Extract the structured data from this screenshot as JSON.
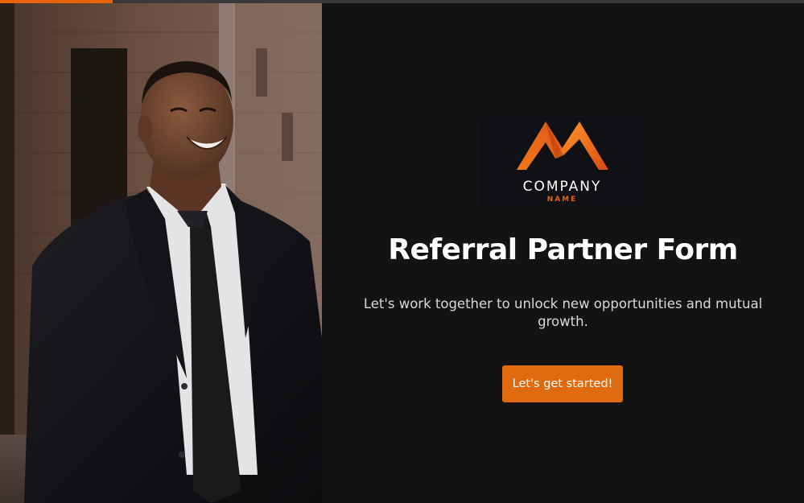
{
  "progress": {
    "fraction": 0.14,
    "color": "#e8630a",
    "track_color": "#3a3a3a"
  },
  "photo": {
    "description_icon": "photo-smiling-man-in-suit"
  },
  "logo": {
    "icon": "mountain-m-logo",
    "company": "COMPANY",
    "name": "NAME",
    "accent_color": "#e8630a"
  },
  "intro": {
    "title": "Referral Partner Form",
    "subtitle": "Let's work together to unlock new opportunities and mutual growth.",
    "start_button_label": "Let's get started!"
  },
  "colors": {
    "background": "#131313",
    "button": "#df6a0f",
    "text": "#ffffff"
  }
}
